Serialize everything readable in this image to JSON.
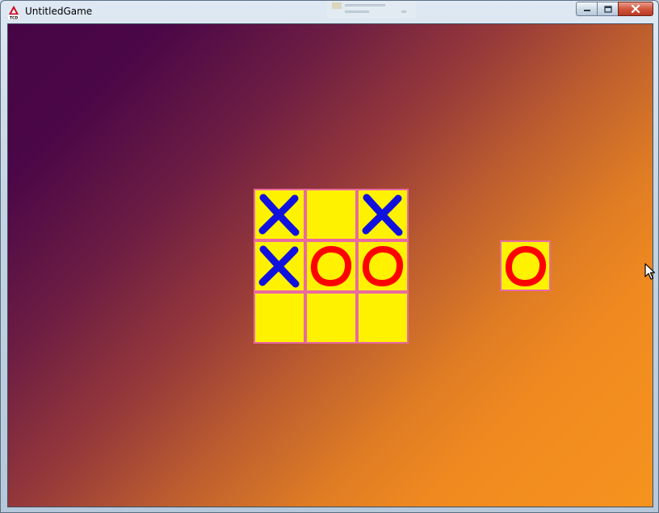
{
  "window": {
    "title": "UntitledGame",
    "app_icon": "tcd-logo-icon",
    "controls": [
      "minimize-icon",
      "maximize-icon",
      "close-icon"
    ]
  },
  "game": {
    "board": [
      [
        "X",
        "",
        "X"
      ],
      [
        "X",
        "O",
        "O"
      ],
      [
        "",
        "",
        ""
      ]
    ],
    "next_piece": "O",
    "colors": {
      "cell": "#fff200",
      "cell_border": "#e96aa0",
      "x_mark": "#1111dd",
      "o_mark": "#ff0000",
      "bg_dark": "#470545",
      "bg_light": "#f6931e"
    }
  }
}
